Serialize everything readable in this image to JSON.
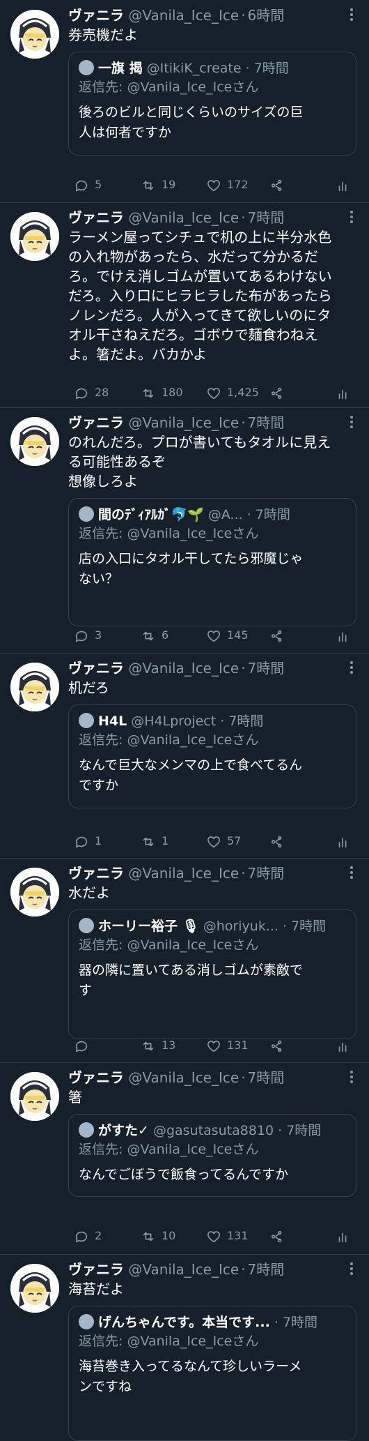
{
  "tweets": [
    {
      "name": "ヴァニラ",
      "handle": "@Vanila_Ice_Ice",
      "time": "6時間",
      "text": "券売機だよ",
      "quote": {
        "name": "一旗 揭",
        "handle": "@ItikiK_create",
        "time": "7時間",
        "reply": "返信先: @Vanila_Ice_Iceさん",
        "text": "後ろのビルと同じくらいのサイズの巨\n人は何者ですか"
      },
      "replies": "5",
      "retweets": "19",
      "likes": "172"
    },
    {
      "name": "ヴァニラ",
      "handle": "@Vanila_Ice_Ice",
      "time": "7時間",
      "text": "ラーメン屋ってシチュで机の上に半分水色\nの入れ物があったら、水だって分かるだ\nろ。でけえ消しゴムが置いてあるわけない\nだろ。入り口にヒラヒラした布があったら\nノレンだろ。人が入ってきて欲しいのにタ\nオル干さねえだろ。ゴボウで麺食わねえ\nよ。箸だよ。バカかよ",
      "replies": "28",
      "retweets": "180",
      "likes": "1,425"
    },
    {
      "name": "ヴァニラ",
      "handle": "@Vanila_Ice_Ice",
      "time": "7時間",
      "text": "のれんだろ。プロが書いてもタオルに見え\nる可能性あるぞ\n想像しろよ",
      "quote": {
        "name": "間のﾃﾞｨｱﾙｶﾞ🐬🌱",
        "handle": "@A...",
        "time": "7時間",
        "reply": "返信先: @Vanila_Ice_Iceさん",
        "text": "店の入口にタオル干してたら邪魔じゃ\nない？"
      },
      "replies": "3",
      "retweets": "6",
      "likes": "145"
    },
    {
      "name": "ヴァニラ",
      "handle": "@Vanila_Ice_Ice",
      "time": "7時間",
      "text": "机だろ",
      "quote": {
        "name": "H4L",
        "handle": "@H4Lproject",
        "time": "7時間",
        "reply": "返信先: @Vanila_Ice_Iceさん",
        "text": "なんで巨大なメンマの上で食べてるん\nですか"
      },
      "replies": "1",
      "retweets": "1",
      "likes": "57"
    },
    {
      "name": "ヴァニラ",
      "handle": "@Vanila_Ice_Ice",
      "time": "7時間",
      "text": "水だよ",
      "quote": {
        "name": "ホーリー裕子 🎙",
        "handle": "@horiyuk...",
        "time": "7時間",
        "reply": "返信先: @Vanila_Ice_Iceさん",
        "text": "器の隣に置いてある消しゴムが素敵で\nす"
      },
      "replies": "",
      "retweets": "13",
      "likes": "131"
    },
    {
      "name": "ヴァニラ",
      "handle": "@Vanila_Ice_Ice",
      "time": "7時間",
      "text": "箸",
      "quote": {
        "name": "がすた✓",
        "handle": "@gasutasuta8810",
        "time": "7時間",
        "reply": "返信先: @Vanila_Ice_Iceさん",
        "text": "なんでごぼうで飯食ってるんですか"
      },
      "replies": "2",
      "retweets": "10",
      "likes": "131"
    },
    {
      "name": "ヴァニラ",
      "handle": "@Vanila_Ice_Ice",
      "time": "7時間",
      "text": "海苔だよ",
      "quote": {
        "name": "げんちゃんです。本当です...",
        "handle": "",
        "time": "7時間",
        "reply": "返信先: @Vanila_Ice_Iceさん",
        "text": "海苔巻き入ってるなんて珍しいラーメ\nンですね"
      }
    }
  ]
}
